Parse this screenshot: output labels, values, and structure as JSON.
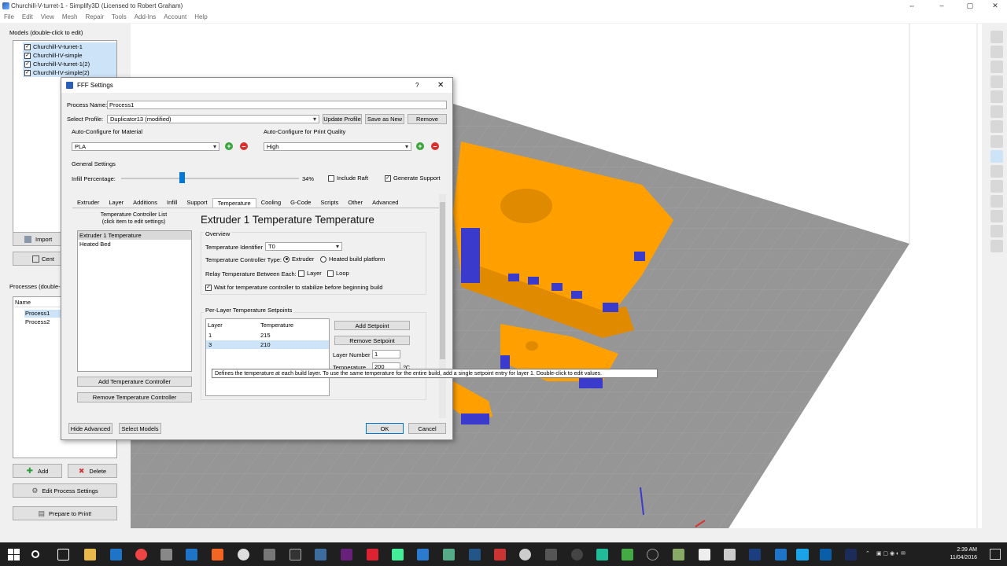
{
  "window": {
    "title": "Churchill-V-turret-1 - Simplify3D (Licensed to Robert Graham)",
    "restore_symbol": "⇔",
    "min_symbol": "–",
    "max_symbol": "▢",
    "close_symbol": "✕"
  },
  "menu": [
    "File",
    "Edit",
    "View",
    "Mesh",
    "Repair",
    "Tools",
    "Add-Ins",
    "Account",
    "Help"
  ],
  "models": {
    "header": "Models (double-click to edit)",
    "items": [
      "Churchill-V-turret-1",
      "Churchill-IV-simple",
      "Churchill-V-turret-1(2)",
      "Churchill-IV-simple(2)"
    ],
    "import_label": "Import",
    "center_label": "Cent"
  },
  "processes": {
    "header": "Processes (double-c",
    "column": "Name",
    "items": [
      "Process1",
      "Process2"
    ],
    "add_label": "Add",
    "delete_label": "Delete",
    "edit_label": "Edit Process Settings",
    "prepare_label": "Prepare to Print!"
  },
  "dialog": {
    "title": "FFF Settings",
    "help": "?",
    "close": "✕",
    "process_name_label": "Process Name:",
    "process_name_value": "Process1",
    "select_profile_label": "Select Profile:",
    "profile_value": "Duplicator13 (modified)",
    "update_profile": "Update Profile",
    "save_as_new": "Save as New",
    "remove": "Remove",
    "material_label": "Auto-Configure for Material",
    "material_value": "PLA",
    "quality_label": "Auto-Configure for Print Quality",
    "quality_value": "High",
    "general_settings": "General Settings",
    "infill_label": "Infill Percentage:",
    "infill_value": "34%",
    "infill_fraction": 0.34,
    "include_raft": "Include Raft",
    "include_raft_checked": false,
    "generate_support": "Generate Support",
    "generate_support_checked": true,
    "tabs": [
      "Extruder",
      "Layer",
      "Additions",
      "Infill",
      "Support",
      "Temperature",
      "Cooling",
      "G-Code",
      "Scripts",
      "Other",
      "Advanced"
    ],
    "active_tab": "Temperature",
    "tc_list_header": "Temperature Controller List\n(click item to edit settings)",
    "tc_items": [
      "Extruder 1 Temperature",
      "Heated Bed"
    ],
    "add_tc": "Add Temperature Controller",
    "remove_tc": "Remove Temperature Controller",
    "heading": "Extruder 1 Temperature Temperature",
    "overview": "Overview",
    "temp_id_label": "Temperature Identifier",
    "temp_id_value": "T0",
    "ctrl_type_label": "Temperature Controller Type:",
    "ctrl_type_extruder": "Extruder",
    "ctrl_type_bed": "Heated build platform",
    "relay_label": "Relay Temperature Between Each:",
    "relay_layer": "Layer",
    "relay_loop": "Loop",
    "wait_label": "Wait for temperature controller to stabilize before beginning build",
    "setpoints_label": "Per-Layer Temperature Setpoints",
    "setpoint_cols": [
      "Layer",
      "Temperature"
    ],
    "setpoints": [
      [
        "1",
        "215"
      ],
      [
        "3",
        "210"
      ]
    ],
    "add_setpoint": "Add Setpoint",
    "remove_setpoint": "Remove Setpoint",
    "layer_number_label": "Layer Number",
    "layer_number_value": "1",
    "temperature_label": "Temperature",
    "temperature_value": "200",
    "temperature_unit": "ºC",
    "tooltip": "Defines the temperature at each build layer.  To use the same temperature for the entire build, add a single setpoint entry for layer 1.  Double-click to edit values.",
    "hide_advanced": "Hide Advanced",
    "select_models": "Select Models",
    "ok": "OK",
    "cancel": "Cancel"
  },
  "taskbar": {
    "time": "2:39 AM",
    "date": "11/04/2016",
    "lang": "ENG"
  },
  "colors": {
    "model": "#ffa000",
    "support": "#3a3acc",
    "bed": "#969696",
    "accent": "#0078d7"
  }
}
